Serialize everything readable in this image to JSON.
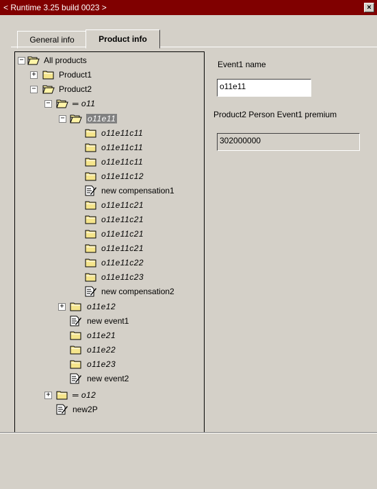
{
  "window": {
    "title": "< Runtime 3.25 build 0023 >",
    "close_glyph": "×"
  },
  "tabs": [
    {
      "label": "General info",
      "active": false
    },
    {
      "label": "Product info",
      "active": true
    }
  ],
  "tree": {
    "nodes": [
      {
        "label": "All products",
        "expander": "−",
        "icon": "open-folder-icon",
        "italic": false
      },
      {
        "label": "Product1",
        "expander": "+",
        "icon": "folder-icon",
        "italic": false
      },
      {
        "label": "Product2",
        "expander": "−",
        "icon": "open-folder-icon",
        "italic": false
      },
      {
        "label": "o11",
        "expander": "−",
        "icon": "open-folder-icon",
        "italic": true,
        "dash": "═"
      },
      {
        "label": "o11e11",
        "expander": "−",
        "icon": "open-folder-icon",
        "italic": true,
        "selected": true
      },
      {
        "label": "o11e11c11",
        "icon": "folder-icon",
        "italic": true
      },
      {
        "label": "o11e11c11",
        "icon": "folder-icon",
        "italic": true
      },
      {
        "label": "o11e11c11",
        "icon": "folder-icon",
        "italic": true
      },
      {
        "label": "o11e11c12",
        "icon": "folder-icon",
        "italic": true
      },
      {
        "label": "new compensation1",
        "icon": "document-edit-icon",
        "italic": false
      },
      {
        "label": "o11e11c21",
        "icon": "folder-icon",
        "italic": true
      },
      {
        "label": "o11e11c21",
        "icon": "folder-icon",
        "italic": true
      },
      {
        "label": "o11e11c21",
        "icon": "folder-icon",
        "italic": true
      },
      {
        "label": "o11e11c21",
        "icon": "folder-icon",
        "italic": true
      },
      {
        "label": "o11e11c22",
        "icon": "folder-icon",
        "italic": true
      },
      {
        "label": "o11e11c23",
        "icon": "folder-icon",
        "italic": true
      },
      {
        "label": "new compensation2",
        "icon": "document-edit-icon",
        "italic": false
      },
      {
        "label": "o11e12",
        "expander": "+",
        "icon": "folder-icon",
        "italic": true
      },
      {
        "label": "new event1",
        "icon": "document-edit-icon",
        "italic": false
      },
      {
        "label": "o11e21",
        "icon": "folder-icon",
        "italic": true
      },
      {
        "label": "o11e22",
        "icon": "folder-icon",
        "italic": true
      },
      {
        "label": "o11e23",
        "icon": "folder-icon",
        "italic": true
      },
      {
        "label": "new event2",
        "icon": "document-edit-icon",
        "italic": false
      },
      {
        "label": "o12",
        "expander": "+",
        "icon": "folder-icon",
        "italic": true,
        "dash": "═"
      },
      {
        "label": "new2P",
        "icon": "document-edit-icon",
        "italic": false
      }
    ]
  },
  "details": {
    "event_name_label": "Event1 name",
    "event_name_value": "o11e11",
    "premium_label": "Product2 Person Event1 premium",
    "premium_value": "302000000"
  }
}
